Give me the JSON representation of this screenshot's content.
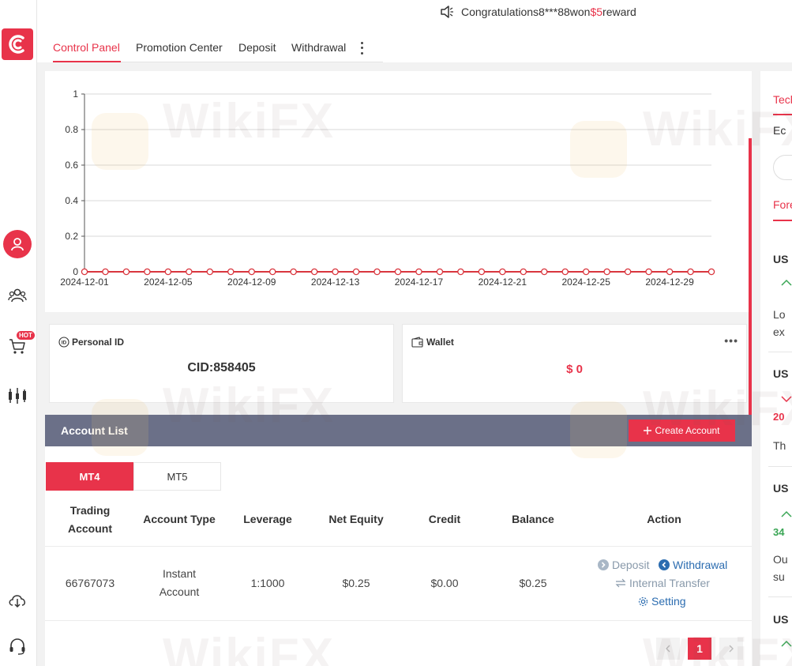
{
  "notice": {
    "text_prefix": "Congratulations8***88won",
    "amount": "$5",
    "text_suffix": "reward"
  },
  "tabs": [
    "Control Panel",
    "Promotion Center",
    "Deposit",
    "Withdrawal"
  ],
  "chart_data": {
    "type": "line",
    "x": [
      "2024-12-01",
      "2024-12-02",
      "2024-12-03",
      "2024-12-04",
      "2024-12-05",
      "2024-12-06",
      "2024-12-07",
      "2024-12-08",
      "2024-12-09",
      "2024-12-10",
      "2024-12-11",
      "2024-12-12",
      "2024-12-13",
      "2024-12-14",
      "2024-12-15",
      "2024-12-16",
      "2024-12-17",
      "2024-12-18",
      "2024-12-19",
      "2024-12-20",
      "2024-12-21",
      "2024-12-22",
      "2024-12-23",
      "2024-12-24",
      "2024-12-25",
      "2024-12-26",
      "2024-12-27",
      "2024-12-28",
      "2024-12-29",
      "2024-12-30",
      "2024-12-31"
    ],
    "values": [
      0,
      0,
      0,
      0,
      0,
      0,
      0,
      0,
      0,
      0,
      0,
      0,
      0,
      0,
      0,
      0,
      0,
      0,
      0,
      0,
      0,
      0,
      0,
      0,
      0,
      0,
      0,
      0,
      0,
      0,
      0
    ],
    "x_tick_labels": [
      "2024-12-01",
      "2024-12-05",
      "2024-12-09",
      "2024-12-13",
      "2024-12-17",
      "2024-12-21",
      "2024-12-25",
      "2024-12-29"
    ],
    "y_ticks": [
      "0",
      "0.2",
      "0.4",
      "0.6",
      "0.8",
      "1"
    ],
    "ylim": [
      0,
      1
    ],
    "grid": true,
    "color": "#d9363e"
  },
  "personal": {
    "label": "Personal ID",
    "cid": "CID:858405"
  },
  "wallet": {
    "label": "Wallet",
    "value": "$ 0"
  },
  "account_list": {
    "title": "Account List",
    "create_label": "Create Account",
    "platforms": [
      "MT4",
      "MT5"
    ],
    "columns": [
      "Trading Account",
      "Account Type",
      "Leverage",
      "Net Equity",
      "Credit",
      "Balance",
      "Action"
    ],
    "rows": [
      {
        "account": "66767073",
        "type": "Instant Account",
        "leverage": "1:1000",
        "net_equity": "$0.25",
        "credit": "$0.00",
        "balance": "$0.25"
      }
    ],
    "actions": {
      "deposit": "Deposit",
      "withdrawal": "Withdrawal",
      "transfer": "Internal Transfer",
      "setting": "Setting"
    },
    "page": "1"
  },
  "right_panel": {
    "items": [
      "Tech",
      "Ec",
      "Fore",
      "US",
      "Lo",
      "ex",
      "US",
      "20",
      "Th",
      "US",
      "34",
      "Ou",
      "su",
      "US"
    ]
  },
  "watermark": "WikiFX",
  "colors": {
    "accent": "#e8334a",
    "header_bar": "#6b7088",
    "link_blue": "#2b6cb0",
    "link_gray": "#8899aa",
    "gain_green": "#3aa655"
  }
}
